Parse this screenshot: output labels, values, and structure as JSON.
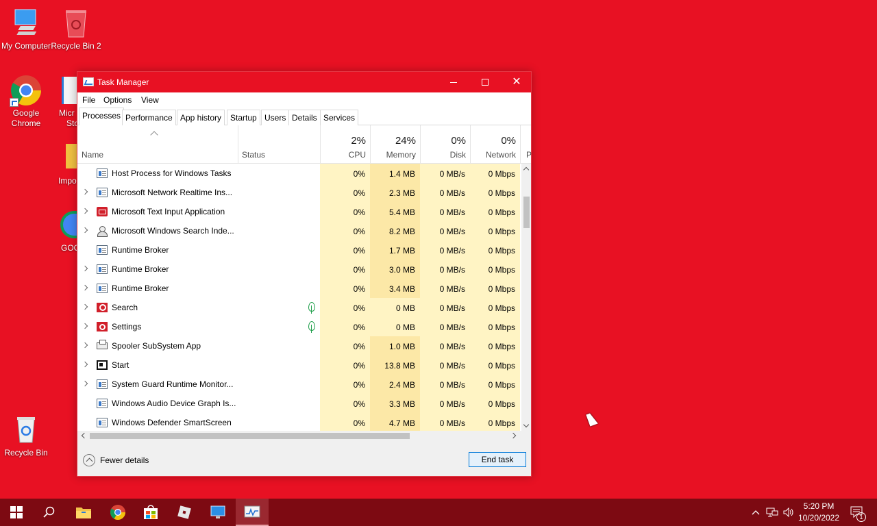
{
  "desktop": {
    "icons": [
      {
        "label": "My Computer",
        "icon": "computer-icon"
      },
      {
        "label": "Recycle Bin 2",
        "icon": "recycle-bin-icon"
      },
      {
        "label": "Google Chrome",
        "icon": "chrome-icon"
      },
      {
        "label": "Recycle Bin",
        "icon": "recycle-bin-icon"
      }
    ],
    "partial_labels": [
      "Micr",
      "Sto",
      "Impo",
      "GOO"
    ]
  },
  "window": {
    "title": "Task Manager",
    "menu": [
      "File",
      "Options",
      "View"
    ],
    "tabs": [
      "Processes",
      "Performance",
      "App history",
      "Startup",
      "Users",
      "Details",
      "Services"
    ],
    "active_tab": "Processes"
  },
  "columns": {
    "name": "Name",
    "status": "Status",
    "cpu": {
      "pct": "2%",
      "label": "CPU"
    },
    "memory": {
      "pct": "24%",
      "label": "Memory"
    },
    "disk": {
      "pct": "0%",
      "label": "Disk"
    },
    "network": {
      "pct": "0%",
      "label": "Network"
    },
    "partial": "P"
  },
  "processes": [
    {
      "name": "Host Process for Windows Tasks",
      "expandable": false,
      "icon": "window-icon",
      "status_leaf": false,
      "cpu": "0%",
      "memory": "1.4 MB",
      "disk": "0 MB/s",
      "network": "0 Mbps"
    },
    {
      "name": "Microsoft Network Realtime Ins...",
      "expandable": true,
      "icon": "window-icon",
      "status_leaf": false,
      "cpu": "0%",
      "memory": "2.3 MB",
      "disk": "0 MB/s",
      "network": "0 Mbps"
    },
    {
      "name": "Microsoft Text Input Application",
      "expandable": true,
      "icon": "keyboard-icon",
      "status_leaf": false,
      "cpu": "0%",
      "memory": "5.4 MB",
      "disk": "0 MB/s",
      "network": "0 Mbps"
    },
    {
      "name": "Microsoft Windows Search Inde...",
      "expandable": true,
      "icon": "person-icon",
      "status_leaf": false,
      "cpu": "0%",
      "memory": "8.2 MB",
      "disk": "0 MB/s",
      "network": "0 Mbps"
    },
    {
      "name": "Runtime Broker",
      "expandable": false,
      "icon": "window-icon",
      "status_leaf": false,
      "cpu": "0%",
      "memory": "1.7 MB",
      "disk": "0 MB/s",
      "network": "0 Mbps"
    },
    {
      "name": "Runtime Broker",
      "expandable": true,
      "icon": "window-icon",
      "status_leaf": false,
      "cpu": "0%",
      "memory": "3.0 MB",
      "disk": "0 MB/s",
      "network": "0 Mbps"
    },
    {
      "name": "Runtime Broker",
      "expandable": true,
      "icon": "window-icon",
      "status_leaf": false,
      "cpu": "0%",
      "memory": "3.4 MB",
      "disk": "0 MB/s",
      "network": "0 Mbps"
    },
    {
      "name": "Search",
      "expandable": true,
      "icon": "search-icon",
      "status_leaf": true,
      "cpu": "0%",
      "memory": "0 MB",
      "disk": "0 MB/s",
      "network": "0 Mbps"
    },
    {
      "name": "Settings",
      "expandable": true,
      "icon": "gear-icon",
      "status_leaf": true,
      "cpu": "0%",
      "memory": "0 MB",
      "disk": "0 MB/s",
      "network": "0 Mbps"
    },
    {
      "name": "Spooler SubSystem App",
      "expandable": true,
      "icon": "printer-icon",
      "status_leaf": false,
      "cpu": "0%",
      "memory": "1.0 MB",
      "disk": "0 MB/s",
      "network": "0 Mbps"
    },
    {
      "name": "Start",
      "expandable": true,
      "icon": "start-icon",
      "status_leaf": false,
      "cpu": "0%",
      "memory": "13.8 MB",
      "disk": "0 MB/s",
      "network": "0 Mbps"
    },
    {
      "name": "System Guard Runtime Monitor...",
      "expandable": true,
      "icon": "window-icon",
      "status_leaf": false,
      "cpu": "0%",
      "memory": "2.4 MB",
      "disk": "0 MB/s",
      "network": "0 Mbps"
    },
    {
      "name": "Windows Audio Device Graph Is...",
      "expandable": false,
      "icon": "window-icon",
      "status_leaf": false,
      "cpu": "0%",
      "memory": "3.3 MB",
      "disk": "0 MB/s",
      "network": "0 Mbps"
    },
    {
      "name": "Windows Defender SmartScreen",
      "expandable": false,
      "icon": "window-icon",
      "status_leaf": false,
      "cpu": "0%",
      "memory": "4.7 MB",
      "disk": "0 MB/s",
      "network": "0 Mbps"
    }
  ],
  "footer": {
    "fewer_details": "Fewer details",
    "end_task": "End task"
  },
  "taskbar": {
    "apps": [
      "start-icon",
      "search-icon",
      "file-explorer-icon",
      "chrome-icon",
      "store-icon",
      "roblox-icon",
      "remote-desktop-icon",
      "task-manager-icon"
    ],
    "time": "5:20 PM",
    "date": "10/20/2022",
    "notification_count": "1"
  },
  "colors": {
    "desktop": "#e81123",
    "taskbar": "#7d0a12",
    "accent": "#0078d7"
  }
}
